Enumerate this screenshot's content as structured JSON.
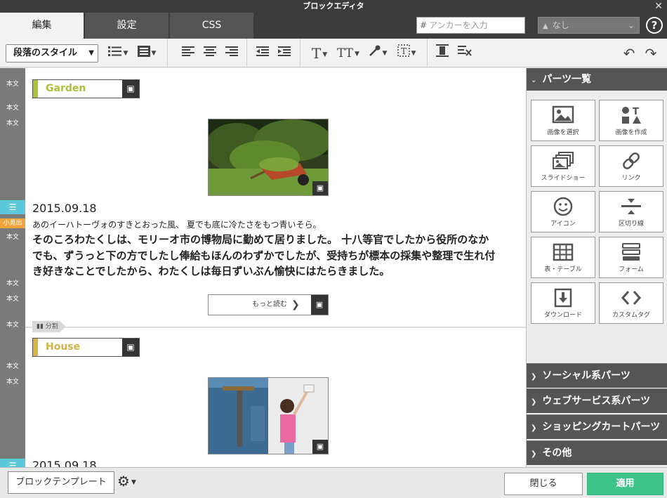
{
  "window": {
    "title": "ブロックエディタ",
    "close_glyph": "✕"
  },
  "tabs": [
    {
      "label": "編集",
      "active": true
    },
    {
      "label": "設定",
      "active": false
    },
    {
      "label": "CSS",
      "active": false
    }
  ],
  "anchor": {
    "placeholder": "アンカーを入力",
    "hash": "#"
  },
  "naki_select": {
    "value": "なし"
  },
  "help": {
    "label": "?"
  },
  "toolbar": {
    "style_select": "段落のスタイル"
  },
  "gutter": {
    "labels": [
      "本文",
      "本文",
      "本文",
      "小見出",
      "本文",
      "本文",
      "本文",
      "本文",
      "本文",
      "本文"
    ]
  },
  "content": {
    "block1": {
      "heading": "Garden",
      "heading_color": "#a7c23a",
      "date": "2015.09.18",
      "subtitle": "あのイーハトーヴォのすきとおった風、 夏でも底に冷たさをもつ青いそら。",
      "paragraph": "そのころわたくしは、モリーオ市の博物局に勤めて居りました。 十八等官でしたから役所のなかでも、ずうっと下の方でしたし俸給もほんのわずかでしたが、受持ちが標本の採集や整理で生れ付き好きなことでしたから、わたくしは毎日ずいぶん愉快にはたらきました。",
      "more_label": "もっと読む"
    },
    "divider_label": "分割",
    "block2": {
      "heading": "House",
      "heading_color": "#d4b347",
      "date": "2015.09.18"
    }
  },
  "panel": {
    "title": "パーツ一覧",
    "parts": [
      {
        "label": "画像を選択",
        "icon": "image-icon"
      },
      {
        "label": "画像を作成",
        "icon": "shapes-icon"
      },
      {
        "label": "スライドショー",
        "icon": "slideshow-icon"
      },
      {
        "label": "リンク",
        "icon": "link-icon"
      },
      {
        "label": "アイコン",
        "icon": "smiley-icon"
      },
      {
        "label": "区切り線",
        "icon": "separator-icon"
      },
      {
        "label": "表・テーブル",
        "icon": "table-icon"
      },
      {
        "label": "フォーム",
        "icon": "form-icon"
      },
      {
        "label": "ダウンロード",
        "icon": "download-icon"
      },
      {
        "label": "カスタムタグ",
        "icon": "code-icon"
      }
    ],
    "sections": [
      {
        "label": "ソーシャル系パーツ"
      },
      {
        "label": "ウェブサービス系パーツ"
      },
      {
        "label": "ショッピングカートパーツ"
      },
      {
        "label": "その他"
      }
    ]
  },
  "footer": {
    "template_button": "ブロックテンプレート",
    "close_button": "閉じる",
    "apply_button": "適用"
  },
  "colors": {
    "accent_green": "#3ec48a",
    "gutter_blue": "#5bc8dc",
    "gutter_orange": "#f2a33b"
  }
}
